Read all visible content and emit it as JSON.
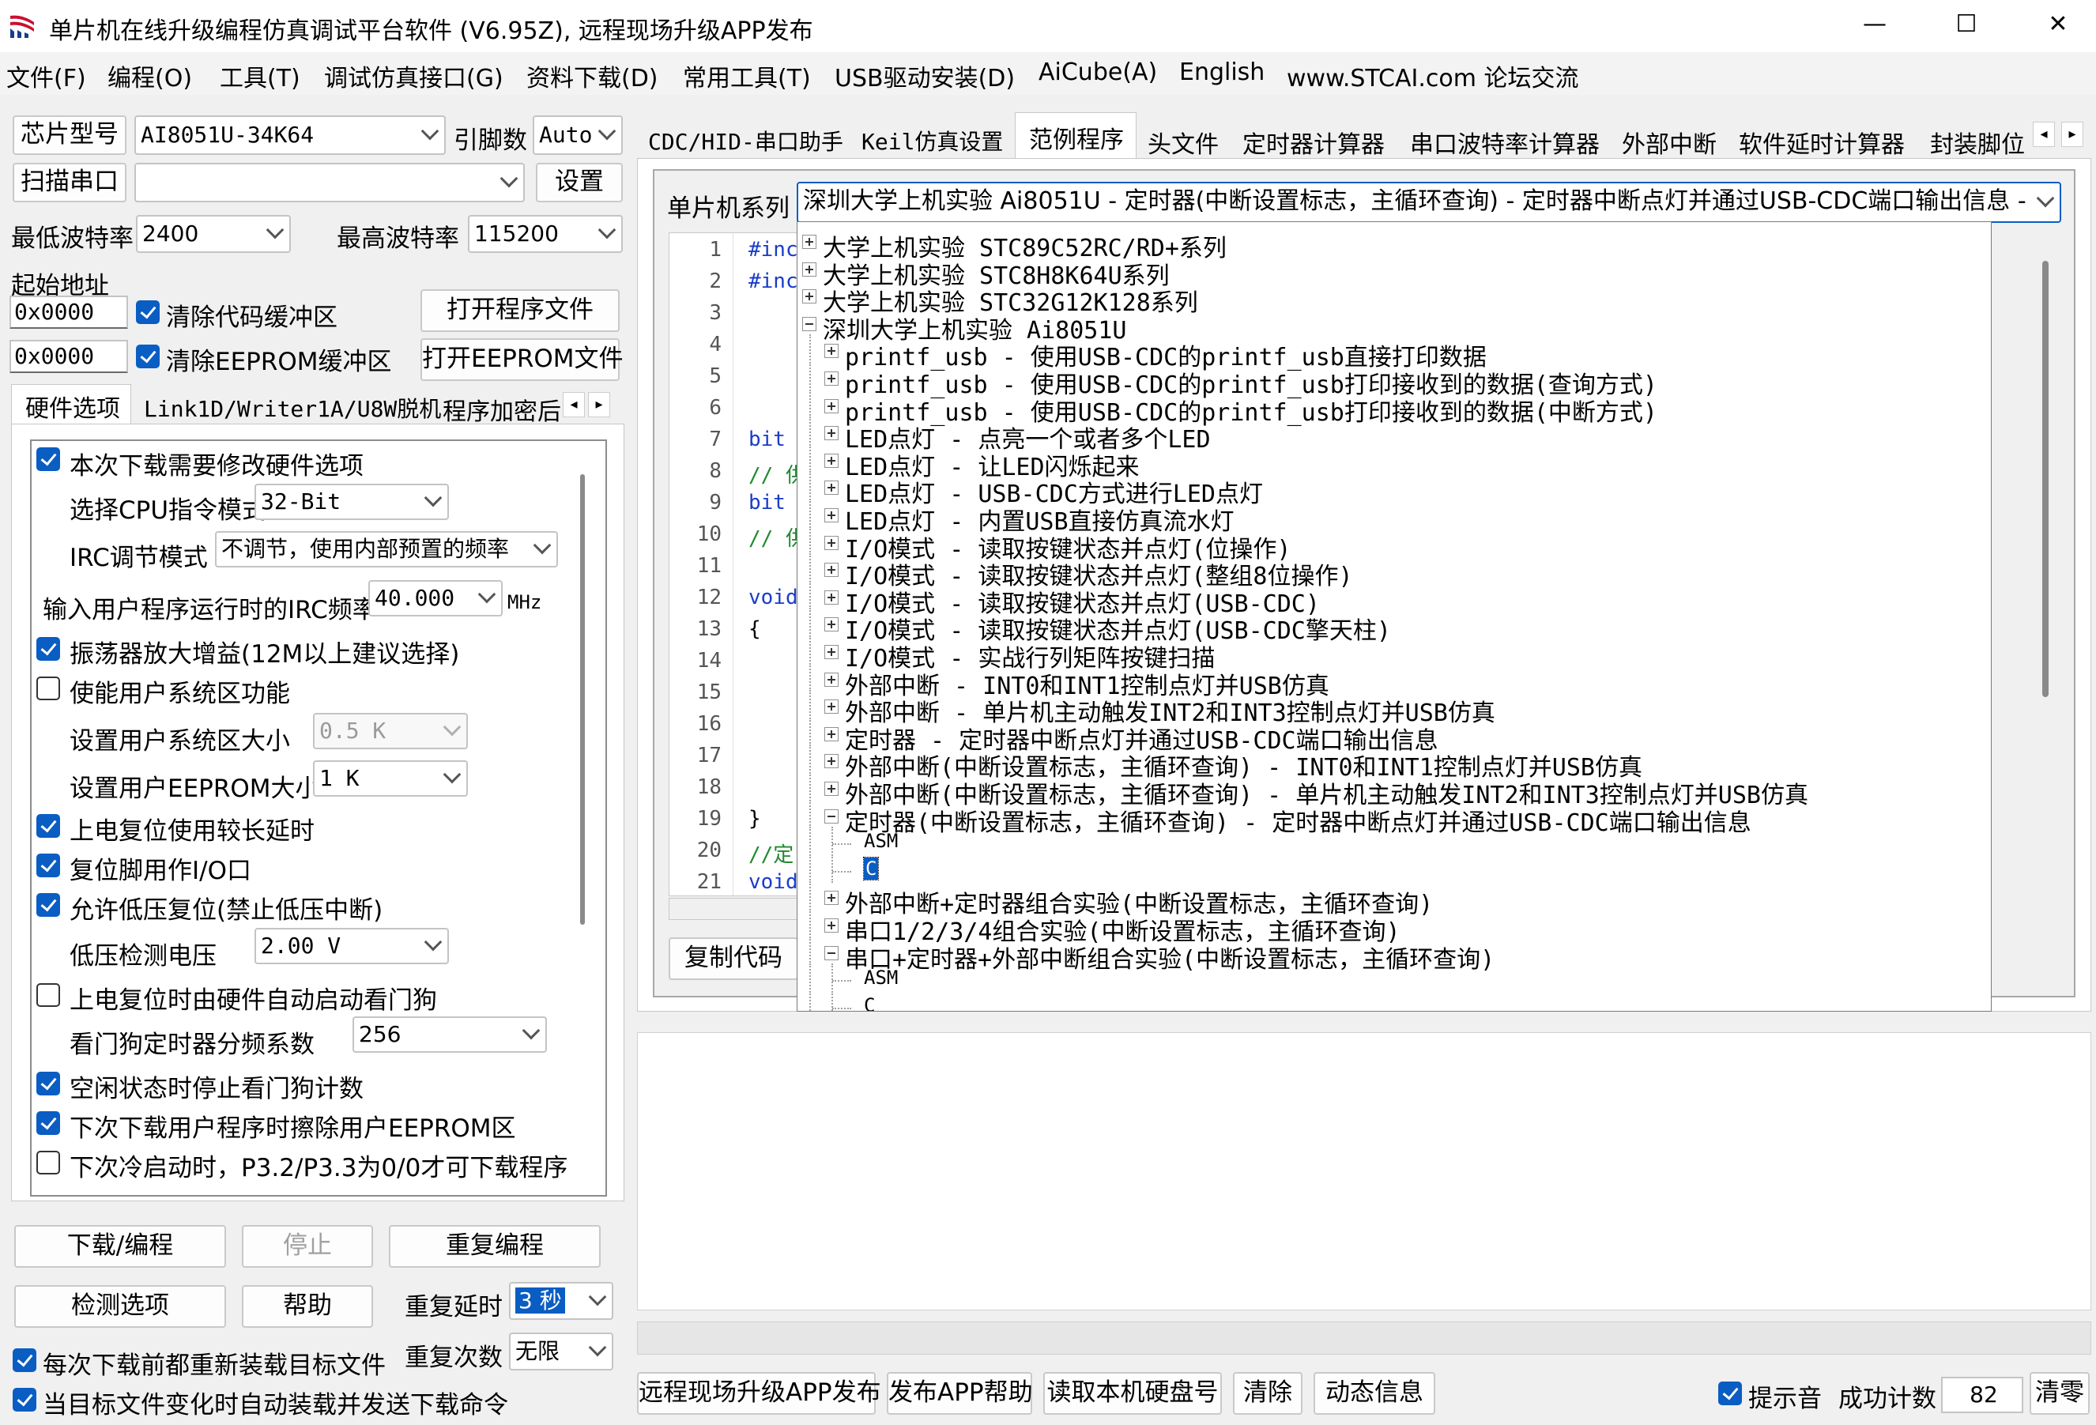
{
  "window": {
    "title": "单片机在线升级编程仿真调试平台软件 (V6.95Z), 远程现场升级APP发布",
    "minimize": "—",
    "maximize": "☐",
    "close": "✕"
  },
  "menu": [
    "文件(F)",
    "编程(O)",
    "工具(T)",
    "调试仿真接口(G)",
    "资料下载(D)",
    "常用工具(T)",
    "USB驱动安装(D)",
    "AiCube(A)",
    "English",
    "www.STCAI.com 论坛交流"
  ],
  "left": {
    "chip_label": "芯片型号",
    "chip_value": "AI8051U-34K64",
    "pins_label": "引脚数",
    "pins_value": "Auto",
    "scan_label": "扫描串口",
    "port_value": "",
    "settings_label": "设置",
    "min_baud_label": "最低波特率",
    "min_baud_value": "2400",
    "max_baud_label": "最高波特率",
    "max_baud_value": "115200",
    "start_addr_label": "起始地址",
    "code_addr": "0x0000",
    "clear_code_label": "清除代码缓冲区",
    "open_program_label": "打开程序文件",
    "eeprom_addr": "0x0000",
    "clear_eeprom_label": "清除EEPROM缓冲区",
    "open_eeprom_label": "打开EEPROM文件",
    "tabs": [
      "硬件选项",
      "Link1D/Writer1A/U8W脱机",
      "程序加密后"
    ],
    "hw": {
      "modify_opts": "本次下载需要修改硬件选项",
      "cpu_mode_label": "选择CPU指令模式",
      "cpu_mode_value": "32-Bit",
      "irc_mode_label": "IRC调节模式",
      "irc_mode_value": "不调节，使用内部预置的频率",
      "irc_freq_label": "输入用户程序运行时的IRC频率",
      "irc_freq_value": "40.000",
      "irc_unit": "MHz",
      "osc_gain": "振荡器放大增益(12M以上建议选择)",
      "user_sys": "使能用户系统区功能",
      "user_sys_size_label": "设置用户系统区大小",
      "user_sys_size_value": "0.5 K",
      "user_eeprom_label": "设置用户EEPROM大小",
      "user_eeprom_value": "1   K",
      "power_delay": "上电复位使用较长延时",
      "reset_io": "复位脚用作I/O口",
      "lvr": "允许低压复位(禁止低压中断)",
      "lvd_label": "低压检测电压",
      "lvd_value": "2.00 V",
      "wdt_auto": "上电复位时由硬件自动启动看门狗",
      "wdt_div_label": "看门狗定时器分频系数",
      "wdt_div_value": "256",
      "idle_wdt": "空闲状态时停止看门狗计数",
      "erase_eeprom": "下次下载用户程序时擦除用户EEPROM区",
      "cold_boot": "下次冷启动时，P3.2/P3.3为0/0才可下载程序"
    },
    "download_label": "下载/编程",
    "stop_label": "停止",
    "reprogram_label": "重复编程",
    "check_label": "检测选项",
    "help_label": "帮助",
    "repeat_delay_label": "重复延时",
    "repeat_delay_value": "3 秒",
    "repeat_count_label": "重复次数",
    "repeat_count_value": "无限",
    "reload_each": "每次下载前都重新装载目标文件",
    "auto_reload": "当目标文件变化时自动装载并发送下载命令"
  },
  "right": {
    "tabs": [
      "CDC/HID-串口助手",
      "Keil仿真设置",
      "范例程序",
      "头文件",
      "定时器计算器",
      "串口波特率计算器",
      "外部中断",
      "软件延时计算器",
      "封装脚位"
    ],
    "series_label": "单片机系列",
    "series_value": "深圳大学上机实验 Ai8051U - 定时器(中断设置标志，主循环查询) - 定时器中断点灯并通过USB-CDC端口输出信息 -",
    "copy_code_label": "复制代码",
    "code_lines": [
      {
        "n": "1",
        "t": "#inc"
      },
      {
        "n": "2",
        "t": "#inc"
      },
      {
        "n": "3",
        "t": ""
      },
      {
        "n": "4",
        "t": ""
      },
      {
        "n": "5",
        "t": ""
      },
      {
        "n": "6",
        "t": ""
      },
      {
        "n": "7",
        "t": "bit"
      },
      {
        "n": "8",
        "t": "// 供"
      },
      {
        "n": "9",
        "t": "bit"
      },
      {
        "n": "10",
        "t": "// 供"
      },
      {
        "n": "11",
        "t": ""
      },
      {
        "n": "12",
        "t": "void"
      },
      {
        "n": "13",
        "t": "{"
      },
      {
        "n": "14",
        "t": ""
      },
      {
        "n": "15",
        "t": ""
      },
      {
        "n": "16",
        "t": ""
      },
      {
        "n": "17",
        "t": ""
      },
      {
        "n": "18",
        "t": ""
      },
      {
        "n": "19",
        "t": "}"
      },
      {
        "n": "20",
        "t": "//定"
      },
      {
        "n": "21",
        "t": "void"
      }
    ],
    "tree": [
      {
        "level": 0,
        "box": "plus",
        "text": "大学上机实验 STC89C52RC/RD+系列"
      },
      {
        "level": 0,
        "box": "plus",
        "text": "大学上机实验 STC8H8K64U系列"
      },
      {
        "level": 0,
        "box": "plus",
        "text": "大学上机实验 STC32G12K128系列"
      },
      {
        "level": 0,
        "box": "minus",
        "text": "深圳大学上机实验 Ai8051U"
      },
      {
        "level": 1,
        "box": "plus",
        "text": "printf_usb - 使用USB-CDC的printf_usb直接打印数据"
      },
      {
        "level": 1,
        "box": "plus",
        "text": "printf_usb - 使用USB-CDC的printf_usb打印接收到的数据(查询方式)"
      },
      {
        "level": 1,
        "box": "plus",
        "text": "printf_usb - 使用USB-CDC的printf_usb打印接收到的数据(中断方式)"
      },
      {
        "level": 1,
        "box": "plus",
        "text": "LED点灯 - 点亮一个或者多个LED"
      },
      {
        "level": 1,
        "box": "plus",
        "text": "LED点灯 - 让LED闪烁起来"
      },
      {
        "level": 1,
        "box": "plus",
        "text": "LED点灯 - USB-CDC方式进行LED点灯"
      },
      {
        "level": 1,
        "box": "plus",
        "text": "LED点灯 - 内置USB直接仿真流水灯"
      },
      {
        "level": 1,
        "box": "plus",
        "text": "I/O模式 - 读取按键状态并点灯(位操作)"
      },
      {
        "level": 1,
        "box": "plus",
        "text": "I/O模式 - 读取按键状态并点灯(整组8位操作)"
      },
      {
        "level": 1,
        "box": "plus",
        "text": "I/O模式 - 读取按键状态并点灯(USB-CDC)"
      },
      {
        "level": 1,
        "box": "plus",
        "text": "I/O模式 - 读取按键状态并点灯(USB-CDC擎天柱)"
      },
      {
        "level": 1,
        "box": "plus",
        "text": "I/O模式 - 实战行列矩阵按键扫描"
      },
      {
        "level": 1,
        "box": "plus",
        "text": "外部中断 - INT0和INT1控制点灯并USB仿真"
      },
      {
        "level": 1,
        "box": "plus",
        "text": "外部中断 - 单片机主动触发INT2和INT3控制点灯并USB仿真"
      },
      {
        "level": 1,
        "box": "plus",
        "text": "定时器 - 定时器中断点灯并通过USB-CDC端口输出信息"
      },
      {
        "level": 1,
        "box": "plus",
        "text": "外部中断(中断设置标志，主循环查询) - INT0和INT1控制点灯并USB仿真"
      },
      {
        "level": 1,
        "box": "plus",
        "text": "外部中断(中断设置标志，主循环查询) - 单片机主动触发INT2和INT3控制点灯并USB仿真"
      },
      {
        "level": 1,
        "box": "minus",
        "text": "定时器(中断设置标志，主循环查询) - 定时器中断点灯并通过USB-CDC端口输出信息"
      },
      {
        "level": 2,
        "box": "none",
        "text": "ASM"
      },
      {
        "level": 2,
        "box": "none",
        "text": "C",
        "selected": true
      },
      {
        "level": 1,
        "box": "plus",
        "text": "外部中断+定时器组合实验(中断设置标志，主循环查询)"
      },
      {
        "level": 1,
        "box": "plus",
        "text": "串口1/2/3/4组合实验(中断设置标志，主循环查询)"
      },
      {
        "level": 1,
        "box": "minus",
        "text": "串口+定时器+外部中断组合实验(中断设置标志，主循环查询)"
      },
      {
        "level": 2,
        "box": "none",
        "text": "ASM"
      },
      {
        "level": 2,
        "box": "none",
        "text": "C"
      }
    ],
    "bottom": {
      "remote_publish": "远程现场升级APP发布",
      "publish_help": "发布APP帮助",
      "read_disk": "读取本机硬盘号",
      "clear": "清除",
      "dynamic_info": "动态信息",
      "beep_label": "提示音",
      "success_label": "成功计数",
      "success_value": "82",
      "reset_count": "清零"
    }
  },
  "colors": {
    "accent": "#0a5dc2",
    "selection": "#0a5dc2",
    "code_keyword": "#1a3cc8",
    "code_comment": "#1f8a2e"
  }
}
